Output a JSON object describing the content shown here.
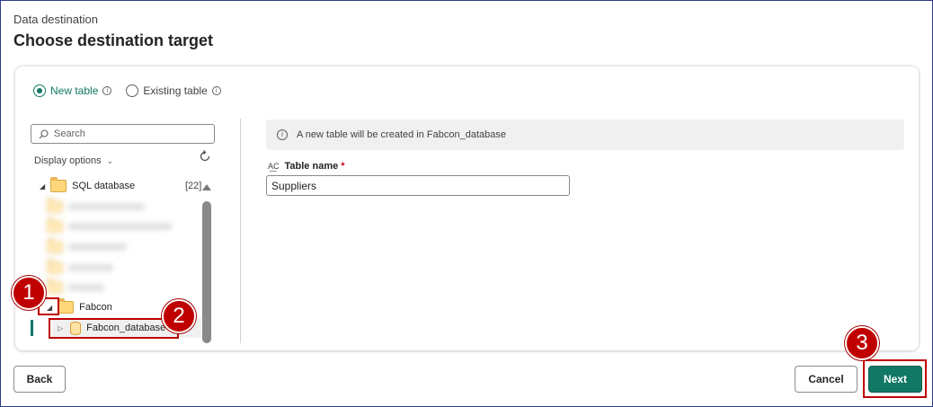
{
  "header": {
    "subtitle": "Data destination",
    "title": "Choose destination target"
  },
  "radio_options": [
    {
      "label": "New table",
      "checked": true
    },
    {
      "label": "Existing table",
      "checked": false
    }
  ],
  "search": {
    "placeholder": "Search"
  },
  "display_options": {
    "label": "Display options"
  },
  "tree": {
    "root": {
      "label": "SQL database",
      "count": "[22]"
    },
    "fabcon": {
      "label": "Fabcon"
    },
    "fabcon_db": {
      "label": "Fabcon_database"
    }
  },
  "info_bar": {
    "text": "A new table will be created in Fabcon_database"
  },
  "table_name": {
    "label": "Table name",
    "required_mark": "*",
    "value": "Suppliers"
  },
  "footer": {
    "back_label": "Back",
    "cancel_label": "Cancel",
    "next_label": "Next"
  },
  "callouts": [
    "1",
    "2",
    "3"
  ],
  "colors": {
    "accent": "#117865",
    "callout": "#c00000"
  }
}
